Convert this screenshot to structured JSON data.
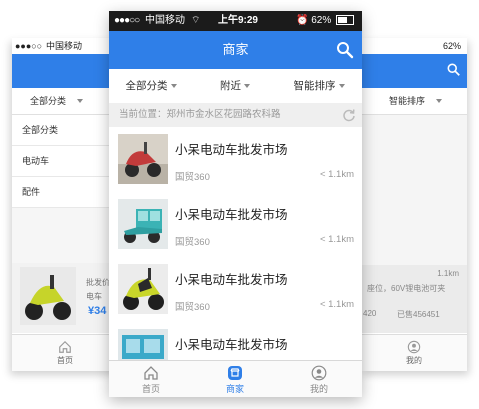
{
  "status": {
    "signal": "●●●○○",
    "carrier": "中国移动",
    "wifi": "⌔",
    "time": "上午9:29",
    "battery": "62%"
  },
  "navbar": {
    "title": "商家",
    "search_icon": "search-icon"
  },
  "filters": [
    {
      "label": "全部分类"
    },
    {
      "label": "附近"
    },
    {
      "label": "智能排序"
    }
  ],
  "location": {
    "prefix": "当前位置：",
    "address": "郑州市金水区花园路农科路"
  },
  "listings": [
    {
      "name": "小呆电动车批发市场",
      "area": "国贸360",
      "distance": "< 1.1km"
    },
    {
      "name": "小呆电动车批发市场",
      "area": "国贸360",
      "distance": "< 1.1km"
    },
    {
      "name": "小呆电动车批发市场",
      "area": "国贸360",
      "distance": "< 1.1km"
    },
    {
      "name": "小呆电动车批发市场",
      "area": "",
      "distance": ""
    }
  ],
  "tabs": [
    {
      "label": "首页",
      "icon": "home-icon"
    },
    {
      "label": "商家",
      "icon": "store-icon",
      "active": true
    },
    {
      "label": "我的",
      "icon": "user-icon"
    }
  ],
  "left_phone": {
    "status_signal": "●●●○○",
    "status_carrier": "中国移动",
    "filter": "全部分类",
    "menu": [
      "全部分类",
      "电动车",
      "配件"
    ],
    "price": "¥34",
    "snippet_a": "批发价",
    "snippet_b": "电车",
    "tab": "首页"
  },
  "right_phone": {
    "battery": "62%",
    "filter": "智能排序",
    "distance": "1.1km",
    "snippet": "座位，60V锂电池可夹",
    "sold_a": "420",
    "sold_b": "已售456451",
    "tab": "我的"
  },
  "colors": {
    "accent": "#2f7fe8",
    "status_bg": "#1b1b1b"
  }
}
